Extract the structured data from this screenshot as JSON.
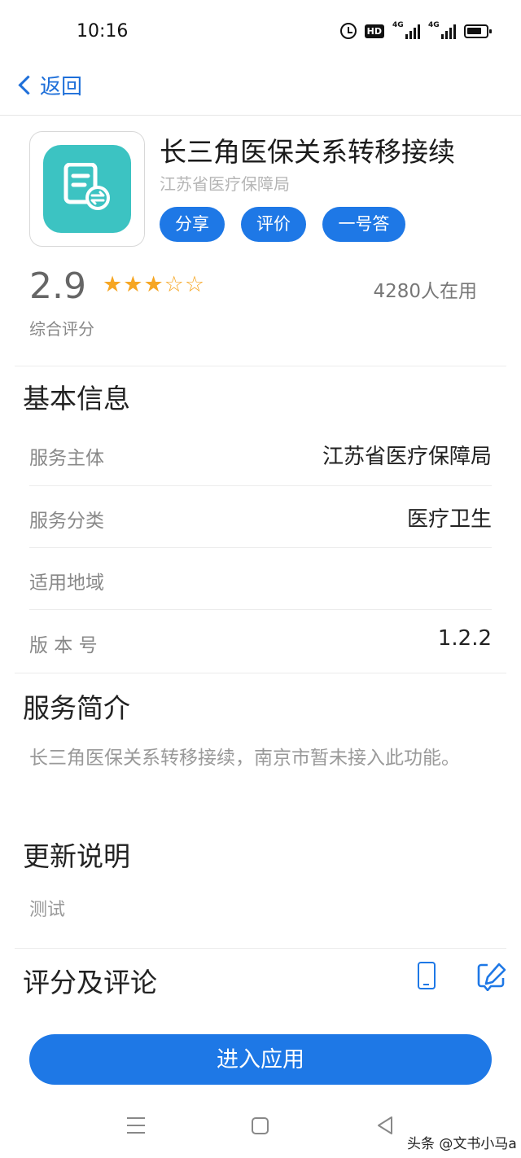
{
  "status_bar": {
    "time": "10:16",
    "hd_label": "HD",
    "signal_1_label": "4G",
    "signal_2_label": "4G"
  },
  "nav": {
    "back_label": "返回"
  },
  "app": {
    "title": "长三角医保关系转移接续",
    "organization": "江苏省医疗保障局",
    "icon_color": "#3cc3c2",
    "actions": {
      "share": "分享",
      "rate": "评价",
      "one_answer": "一号答"
    }
  },
  "rating": {
    "value": "2.9",
    "stars_filled": 3,
    "stars_total": 5,
    "caption": "综合评分",
    "users": "4280人在用"
  },
  "basic_info": {
    "title": "基本信息",
    "rows": [
      {
        "label": "服务主体",
        "value": "江苏省医疗保障局"
      },
      {
        "label": "服务分类",
        "value": "医疗卫生"
      },
      {
        "label": "适用地域",
        "value": ""
      },
      {
        "label": "版 本 号",
        "value": "1.2.2"
      }
    ]
  },
  "service_intro": {
    "title": "服务简介",
    "text": "长三角医保关系转移接续，南京市暂未接入此功能。"
  },
  "update_notes": {
    "title": "更新说明",
    "text": "测试"
  },
  "reviews": {
    "title": "评分及评论"
  },
  "enter_button": {
    "label": "进入应用"
  },
  "watermark": "头条 @文书小马a",
  "colors": {
    "accent": "#1e78e6",
    "star": "#f6a623"
  }
}
